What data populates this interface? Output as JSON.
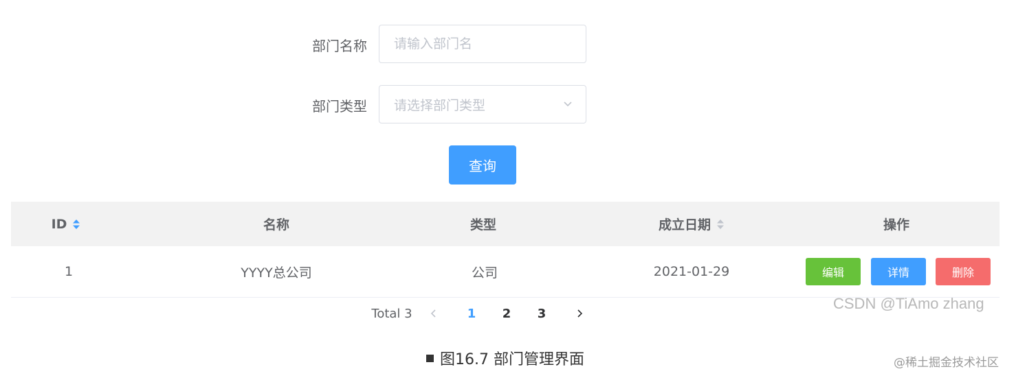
{
  "form": {
    "dept_name_label": "部门名称",
    "dept_name_placeholder": "请输入部门名",
    "dept_type_label": "部门类型",
    "dept_type_placeholder": "请选择部门类型",
    "query_button": "查询"
  },
  "table": {
    "headers": {
      "id": "ID",
      "name": "名称",
      "type": "类型",
      "date": "成立日期",
      "actions": "操作"
    },
    "rows": [
      {
        "id": "1",
        "name": "YYYY总公司",
        "type": "公司",
        "date": "2021-01-29",
        "edit": "编辑",
        "detail": "详情",
        "delete": "删除"
      }
    ]
  },
  "pagination": {
    "total": "Total 3",
    "pages": [
      "1",
      "2",
      "3"
    ],
    "current": "1"
  },
  "watermark": "CSDN @TiAmo zhang",
  "caption": "图16.7 部门管理界面",
  "footer_mark": "@稀土掘金技术社区",
  "colors": {
    "primary": "#409eff",
    "success": "#67c23a",
    "danger": "#f56c6c",
    "header_bg": "#f2f2f2"
  }
}
